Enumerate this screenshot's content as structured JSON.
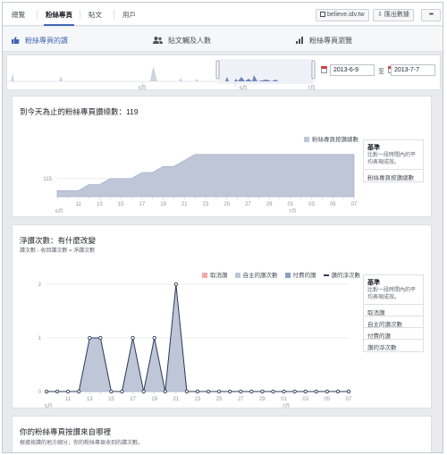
{
  "nav": {
    "tabs": [
      "總覽",
      "粉絲專頁",
      "貼文",
      "用戶"
    ],
    "site_button": "believe.idv.tw",
    "export_button": "匯出數據",
    "more_label": "•••"
  },
  "subtabs": [
    "粉絲專頁的讚",
    "貼文觸及人數",
    "粉絲專頁瀏覽"
  ],
  "timeline": {
    "month_labels": [
      "5月",
      "6月",
      "7月"
    ],
    "start_date": "2013-6-9",
    "to_label": "至",
    "end_date": "2013-7-7"
  },
  "colors": {
    "accent": "#4267b2",
    "area": "#bfc6d8",
    "area_line": "#a9b4cd",
    "line": "#2d3b5a"
  },
  "card1": {
    "title": "到今天為止的粉絲專頁讚總數：119",
    "legend": "粉絲專頁按讚總數",
    "benchmark_title": "基準",
    "benchmark_desc": "比對一段時間內的平均表現成效。",
    "benchmark_items": [
      "粉絲專頁按讚總數"
    ]
  },
  "card2": {
    "title": "淨讚次數：有什麼改變",
    "subtitle": "讚次數 - 收回讚次數 = 淨讚次數",
    "legend": [
      "取消讚",
      "自主的讚次數",
      "付費的讚",
      "讚的淨次數"
    ],
    "legend_colors": [
      "#f4a7a7",
      "#bfc6d8",
      "#8e9ec4",
      "#2d3b5a"
    ],
    "benchmark_title": "基準",
    "benchmark_desc": "比對一段時間內的平均表現成效。",
    "benchmark_items": [
      "取消讚",
      "自主的讚次數",
      "付費的讚",
      "讚的淨次數"
    ]
  },
  "card3": {
    "title": "你的粉絲專頁按讚來自哪裡",
    "subtitle": "根據按讚的地方細分，你的粉絲專頁收到的讚次數。"
  },
  "chart_data": [
    {
      "type": "area",
      "title": "到今天為止的粉絲專頁讚總數：119",
      "x": [
        "09",
        "10",
        "11",
        "12",
        "13",
        "14",
        "15",
        "16",
        "17",
        "18",
        "19",
        "20",
        "21",
        "22",
        "23",
        "24",
        "25",
        "26",
        "27",
        "28",
        "29",
        "30",
        "01",
        "02",
        "03",
        "04",
        "05",
        "06",
        "07"
      ],
      "x_tick_labels": [
        "11",
        "13",
        "15",
        "17",
        "19",
        "21",
        "23",
        "25",
        "27",
        "29",
        "01",
        "03",
        "05",
        "07"
      ],
      "x_month_labels": [
        "6月",
        "7月"
      ],
      "y_tick_labels": [
        "115"
      ],
      "series": [
        {
          "name": "粉絲專頁按讚總數",
          "values": [
            113,
            113,
            113,
            114,
            114,
            115,
            115,
            115,
            116,
            116,
            117,
            117,
            118,
            119,
            119,
            119,
            119,
            119,
            119,
            119,
            119,
            119,
            119,
            119,
            119,
            119,
            119,
            119,
            119
          ]
        }
      ],
      "ylim": [
        112,
        120
      ],
      "grid": true
    },
    {
      "type": "area",
      "title": "淨讚次數：有什麼改變",
      "x": [
        "09",
        "10",
        "11",
        "12",
        "13",
        "14",
        "15",
        "16",
        "17",
        "18",
        "19",
        "20",
        "21",
        "22",
        "23",
        "24",
        "25",
        "26",
        "27",
        "28",
        "29",
        "30",
        "01",
        "02",
        "03",
        "04",
        "05",
        "06",
        "07"
      ],
      "x_tick_labels": [
        "11",
        "13",
        "15",
        "17",
        "19",
        "21",
        "23",
        "25",
        "27",
        "29",
        "01",
        "03",
        "05",
        "07"
      ],
      "x_month_labels": [
        "6月",
        "7月"
      ],
      "y_tick_labels": [
        "0",
        "1",
        "2"
      ],
      "series": [
        {
          "name": "自主的讚次數",
          "values": [
            0,
            0,
            0,
            0,
            1,
            1,
            0,
            0,
            1,
            0,
            1,
            0,
            2,
            0,
            0,
            0,
            0,
            0,
            0,
            0,
            0,
            0,
            0,
            0,
            0,
            0,
            0,
            0,
            0
          ]
        },
        {
          "name": "讚的淨次數",
          "values": [
            0,
            0,
            0,
            0,
            1,
            1,
            0,
            0,
            1,
            0,
            1,
            0,
            2,
            0,
            0,
            0,
            0,
            0,
            0,
            0,
            0,
            0,
            0,
            0,
            0,
            0,
            0,
            0,
            0
          ]
        }
      ],
      "ylim": [
        0,
        2
      ],
      "grid": true
    }
  ]
}
